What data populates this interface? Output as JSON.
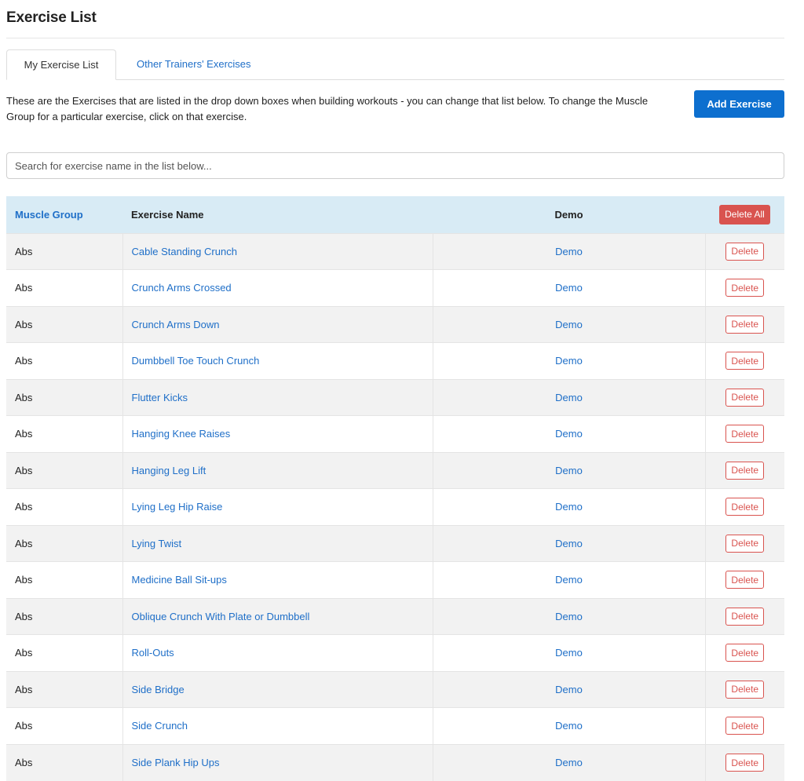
{
  "page": {
    "title": "Exercise List",
    "description": "These are the Exercises that are listed in the drop down boxes when building workouts - you can change that list below. To change the Muscle Group for a particular exercise, click on that exercise.",
    "add_button_label": "Add Exercise",
    "search_placeholder": "Search for exercise name in the list below..."
  },
  "tabs": [
    {
      "label": "My Exercise List",
      "active": true
    },
    {
      "label": "Other Trainers' Exercises",
      "active": false
    }
  ],
  "table": {
    "headers": {
      "muscle_group": "Muscle Group",
      "exercise_name": "Exercise Name",
      "demo": "Demo",
      "delete_all": "Delete All"
    },
    "rows": [
      {
        "group": "Abs",
        "name": "Cable Standing Crunch",
        "demo": "Demo",
        "action": "Delete"
      },
      {
        "group": "Abs",
        "name": "Crunch Arms Crossed",
        "demo": "Demo",
        "action": "Delete"
      },
      {
        "group": "Abs",
        "name": "Crunch Arms Down",
        "demo": "Demo",
        "action": "Delete"
      },
      {
        "group": "Abs",
        "name": "Dumbbell Toe Touch Crunch",
        "demo": "Demo",
        "action": "Delete"
      },
      {
        "group": "Abs",
        "name": "Flutter Kicks",
        "demo": "Demo",
        "action": "Delete"
      },
      {
        "group": "Abs",
        "name": "Hanging Knee Raises",
        "demo": "Demo",
        "action": "Delete"
      },
      {
        "group": "Abs",
        "name": "Hanging Leg Lift",
        "demo": "Demo",
        "action": "Delete"
      },
      {
        "group": "Abs",
        "name": "Lying Leg Hip Raise",
        "demo": "Demo",
        "action": "Delete"
      },
      {
        "group": "Abs",
        "name": "Lying Twist",
        "demo": "Demo",
        "action": "Delete"
      },
      {
        "group": "Abs",
        "name": "Medicine Ball Sit-ups",
        "demo": "Demo",
        "action": "Delete"
      },
      {
        "group": "Abs",
        "name": "Oblique Crunch With Plate or Dumbbell",
        "demo": "Demo",
        "action": "Delete"
      },
      {
        "group": "Abs",
        "name": "Roll-Outs",
        "demo": "Demo",
        "action": "Delete"
      },
      {
        "group": "Abs",
        "name": "Side Bridge",
        "demo": "Demo",
        "action": "Delete"
      },
      {
        "group": "Abs",
        "name": "Side Crunch",
        "demo": "Demo",
        "action": "Delete"
      },
      {
        "group": "Abs",
        "name": "Side Plank Hip Ups",
        "demo": "Demo",
        "action": "Delete"
      }
    ]
  },
  "colors": {
    "accent": "#0d6fcf",
    "link": "#1f6fc8",
    "danger": "#d9534f",
    "header_bg": "#d8ebf5",
    "stripe": "#f2f2f2"
  }
}
